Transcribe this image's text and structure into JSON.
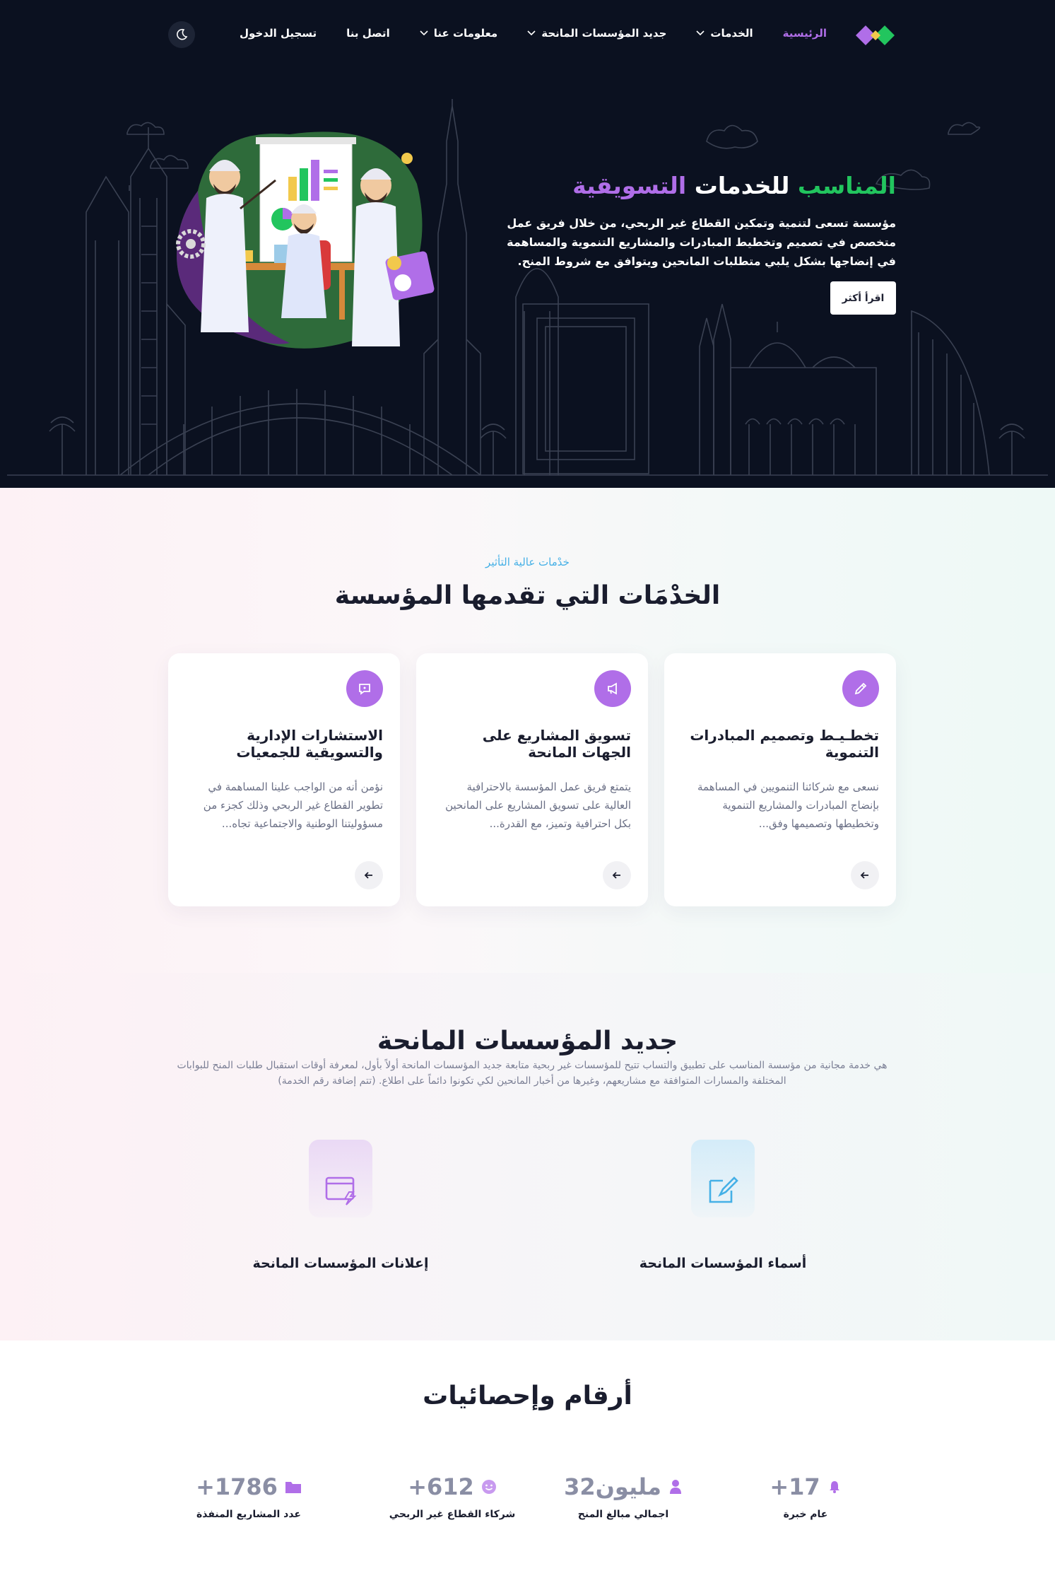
{
  "nav": {
    "links": [
      "الرئيسية",
      "الخدمات",
      "جديد المؤسسات المانحة",
      "معلومات عنا",
      "اتصل بنا",
      "تسجيل الدخول"
    ],
    "active_index": 0,
    "brand_colors": [
      "#b06ee8",
      "#22c55e"
    ]
  },
  "hero": {
    "title_part1": "المناسب",
    "title_part2": "للخدمات",
    "title_part3": "التسويقية",
    "description": "مؤسسة تسعى لتنمية وتمكين القطاع غير الربحي، من خلال فريق عمل متخصص في تصميم وتخطيط المبادرات والمشاريع التنموية والمساهمة في إنضاجها بشكل يلبي متطلبات المانحين ويتوافق مع شروط المنح.",
    "button_label": "اقرأ أكثر"
  },
  "services": {
    "eyebrow": "خدْمات عالية التأثير",
    "title": "الخدْمَات التي تقدمها المؤسسة",
    "cards": [
      {
        "title": "تخطـيـط وتصميم المبادرات التنموية",
        "description": "نسعى مع شركائنا التنمويين في المساهمة بإنضاج المبادرات والمشاريع التنموية وتخطيطها وتصميمها وفق...",
        "icon": "pen-icon"
      },
      {
        "title": "تسويق المشاريع على الجهات المانحة",
        "description": "يتمتع فريق عمل المؤسسة بالاحترافية العالية على تسويق المشاريع على المانحين بكل احترافية وتميز، مع القدرة...",
        "icon": "megaphone-icon"
      },
      {
        "title": "الاستشارات الإدارية والتسويقية للجمعيات",
        "description": "نؤمن أنه من الواجب علينا المساهمة في تطوير القطاع غير الربحي وذلك كجزء من مسؤوليتنا الوطنية والاجتماعية تجاه...",
        "icon": "chat-icon"
      }
    ]
  },
  "grantors": {
    "title": "جديد المؤسسات المانحة",
    "description": "هي خدمة مجانية من مؤسسة المناسب على تطبيق والتساب تتيح للمؤسسات غير ربحية متابعة جديد المؤسسات المانحة أولاً بأول، لمعرفة أوقات استقبال طلبات المنح للبوابات المختلفة والمسارات المتوافقة مع مشاريعهم، وغيرها من أخبار المانحين لكي تكونوا دائماً على اطلاع. (تتم إضافة رقم الخدمة)",
    "features": [
      {
        "label": "أسماء المؤسسات المانحة",
        "icon": "edit-note-icon"
      },
      {
        "label": "إعلانات المؤسسات المانحة",
        "icon": "announcement-window-icon"
      }
    ]
  },
  "stats": {
    "title": "أرقام وإحصائيات",
    "items": [
      {
        "value": "+17",
        "label": "عام خبرة",
        "icon": "bell-icon"
      },
      {
        "value": "32مليون",
        "label": "اجمالي مبالغ المنح",
        "icon": "user-icon"
      },
      {
        "value": "+612",
        "label": "شركاء القطاع غير الربحي",
        "icon": "smile-icon"
      },
      {
        "value": "+1786",
        "label": "عدد المشاريع المنفذة",
        "icon": "folder-icon"
      }
    ]
  },
  "colors": {
    "hero_bg": "#0b1120",
    "accent_purple": "#b06ee8",
    "accent_green": "#22c55e",
    "eyebrow_blue": "#45b0e6"
  }
}
